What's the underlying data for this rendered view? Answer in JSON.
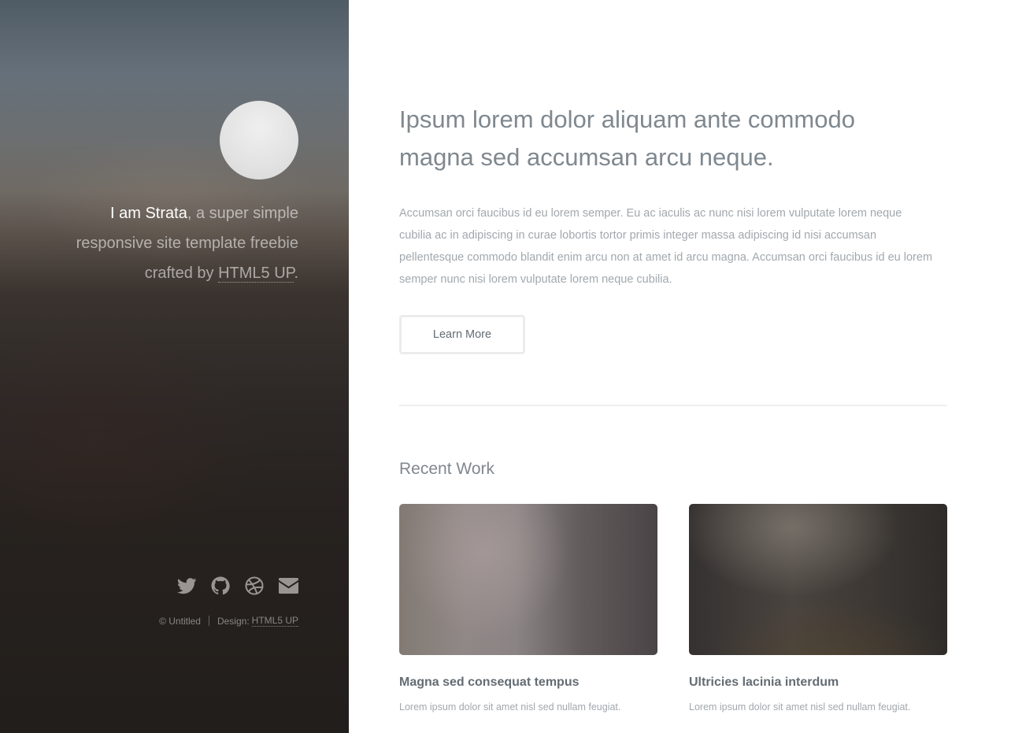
{
  "sidebar": {
    "intro": {
      "name": "I am Strata",
      "rest": ", a super simple responsive site template freebie crafted by ",
      "link_label": "HTML5 UP",
      "end": "."
    },
    "social_icons": [
      "twitter-icon",
      "github-icon",
      "dribbble-icon",
      "envelope-icon"
    ],
    "footer": {
      "copyright": "© Untitled",
      "design_label": "Design:",
      "design_link": "HTML5 UP"
    }
  },
  "main": {
    "headline": "Ipsum lorem dolor aliquam ante commodo magna sed accumsan arcu neque.",
    "paragraph": "Accumsan orci faucibus id eu lorem semper. Eu ac iaculis ac nunc nisi lorem vulputate lorem neque cubilia ac in adipiscing in curae lobortis tortor primis integer massa adipiscing id nisi accumsan pellentesque commodo blandit enim arcu non at amet id arcu magna. Accumsan orci faucibus id eu lorem semper nunc nisi lorem vulputate lorem neque cubilia.",
    "learn_more_label": "Learn More",
    "recent_work": {
      "title": "Recent Work",
      "items": [
        {
          "title": "Magna sed consequat tempus",
          "description": "Lorem ipsum dolor sit amet nisl sed nullam feugiat."
        },
        {
          "title": "Ultricies lacinia interdum",
          "description": "Lorem ipsum dolor sit amet nisl sed nullam feugiat."
        }
      ]
    }
  },
  "colors": {
    "heading": "#7f888f",
    "body_text": "#a2a8ad",
    "sidebar_dark": "#221e1b",
    "button_border": "#ececec"
  }
}
